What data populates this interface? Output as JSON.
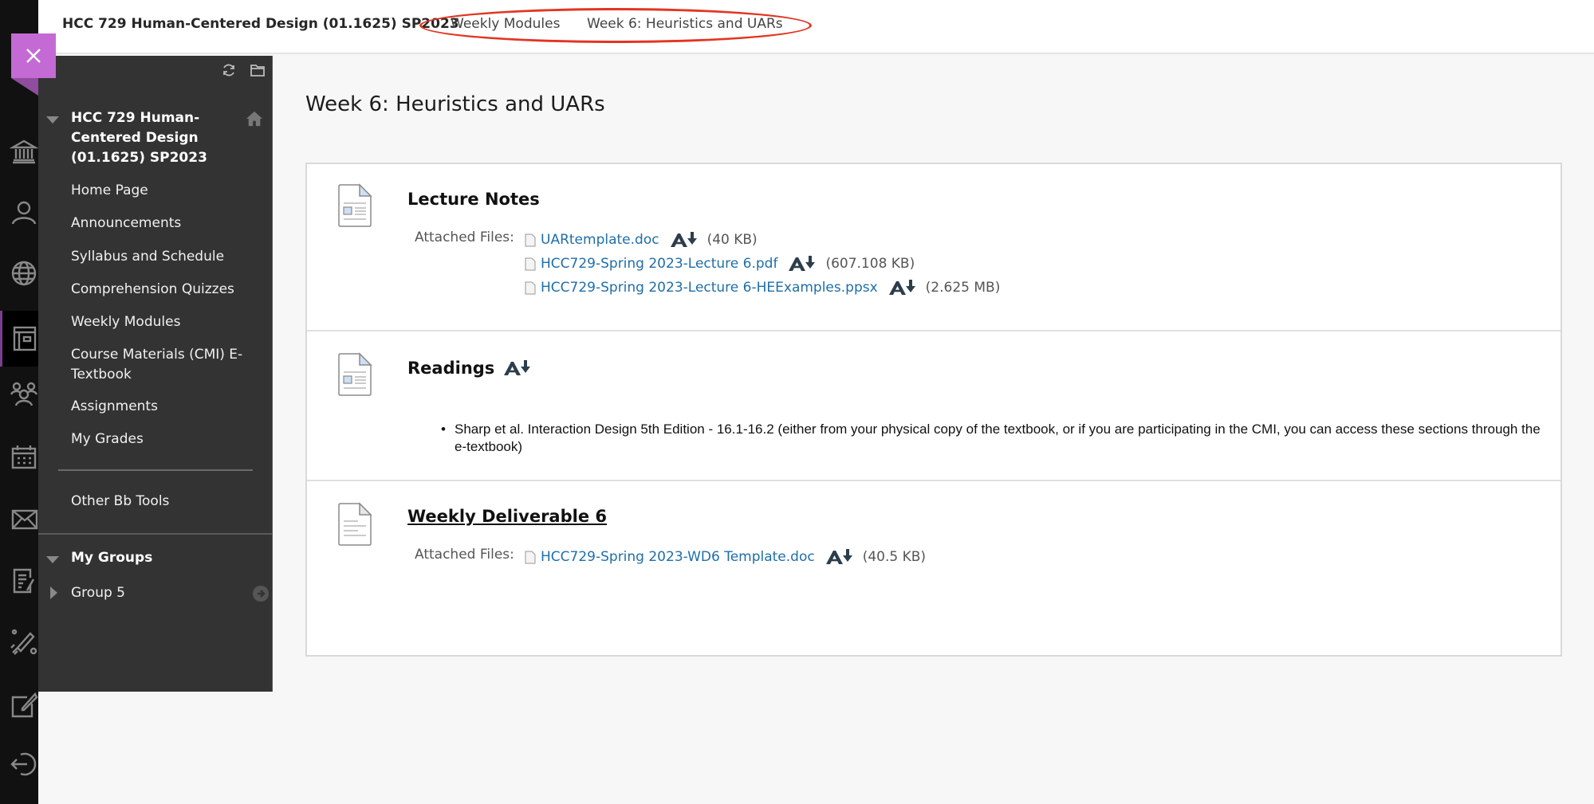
{
  "header": {
    "course_breadcrumb": "HCC 729 Human-Centered Design (01.1625) SP2023",
    "breadcrumbs": [
      "Weekly Modules",
      "Week 6: Heuristics and UARs"
    ]
  },
  "rail": {
    "items": [
      {
        "icon": "institution-icon"
      },
      {
        "icon": "profile-icon"
      },
      {
        "icon": "globe-icon"
      },
      {
        "icon": "courses-icon",
        "active": true
      },
      {
        "icon": "groups-icon"
      },
      {
        "icon": "calendar-icon"
      },
      {
        "icon": "messages-icon"
      },
      {
        "icon": "grades-icon"
      },
      {
        "icon": "tools-icon"
      },
      {
        "icon": "edit-icon"
      },
      {
        "icon": "sign-out-icon"
      }
    ],
    "accent_color": "#7b3d8f"
  },
  "course_menu": {
    "close_color": "#c46ad4",
    "course_title": "HCC 729 Human-Centered Design (01.1625) SP2023",
    "links": [
      "Home Page",
      "Announcements",
      "Syllabus and Schedule",
      "Comprehension Quizzes",
      "Weekly Modules",
      "Course Materials (CMI) E-Textbook",
      "Assignments",
      "My Grades"
    ],
    "other_tools": "Other Bb Tools",
    "groups_title": "My Groups",
    "groups": [
      "Group 5"
    ]
  },
  "main": {
    "page_title": "Week 6: Heuristics and UARs",
    "items": [
      {
        "title": "Lecture Notes",
        "attached_label": "Attached Files:",
        "files": [
          {
            "name": "UARtemplate.doc",
            "size": "(40 KB)"
          },
          {
            "name": "HCC729-Spring 2023-Lecture 6.pdf",
            "size": "(607.108 KB)"
          },
          {
            "name": "HCC729-Spring 2023-Lecture 6-HEExamples.ppsx",
            "size": "(2.625 MB)"
          }
        ]
      },
      {
        "title": "Readings",
        "bullets": [
          "Sharp et al. Interaction Design 5th Edition - 16.1-16.2 (either from your physical copy of the textbook, or if you are participating in the CMI, you can access these sections through the e-textbook)"
        ]
      },
      {
        "title": "Weekly Deliverable 6",
        "attached_label": "Attached Files:",
        "files": [
          {
            "name": "HCC729-Spring 2023-WD6 Template.doc",
            "size": "(40.5 KB)"
          }
        ]
      }
    ],
    "link_color": "#1f6ea8"
  }
}
